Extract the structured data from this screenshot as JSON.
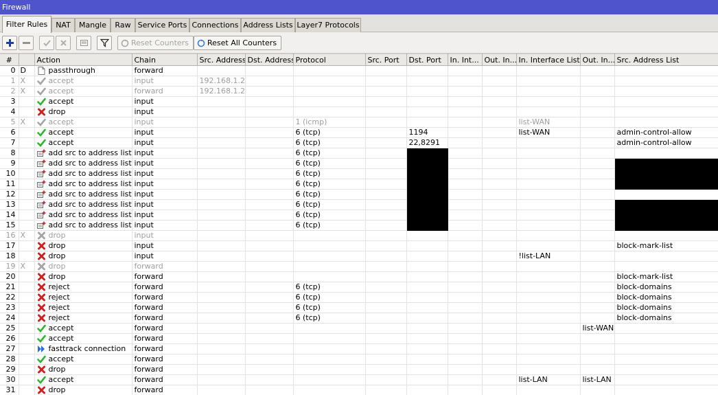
{
  "window": {
    "title": "Firewall"
  },
  "tabs": [
    {
      "label": "Filter Rules",
      "active": true
    },
    {
      "label": "NAT"
    },
    {
      "label": "Mangle"
    },
    {
      "label": "Raw"
    },
    {
      "label": "Service Ports"
    },
    {
      "label": "Connections"
    },
    {
      "label": "Address Lists"
    },
    {
      "label": "Layer7 Protocols"
    }
  ],
  "toolbar": {
    "icons": [
      "add-icon",
      "remove-icon",
      "enable-icon",
      "disable-icon",
      "comment-icon",
      "filter-icon"
    ],
    "reset_counters_label": "Reset Counters",
    "reset_all_counters_label": "Reset All Counters"
  },
  "colors": {
    "accept": "#2fb52f",
    "drop": "#d02020",
    "fasttrack": "#2a6fd6",
    "titlebar": "#4f54cd",
    "redacted": "#000000"
  },
  "table": {
    "columns": [
      "#",
      "",
      "Action",
      "Chain",
      "Src. Address",
      "Dst. Address",
      "Protocol",
      "Src. Port",
      "Dst. Port",
      "In. Int...",
      "Out. In...",
      "In. Interface List",
      "Out. In...",
      "Src. Address List"
    ],
    "rows": [
      {
        "num": "0",
        "flag": "D",
        "action": "passthrough",
        "icon": "passthrough",
        "chain": "forward",
        "disabled": false
      },
      {
        "num": "1",
        "flag": "X",
        "action": "accept",
        "icon": "accept",
        "chain": "input",
        "src": "192.168.1.2",
        "disabled": true
      },
      {
        "num": "2",
        "flag": "X",
        "action": "accept",
        "icon": "accept",
        "chain": "forward",
        "src": "192.168.1.2",
        "disabled": true
      },
      {
        "num": "3",
        "flag": "",
        "action": "accept",
        "icon": "accept",
        "chain": "input"
      },
      {
        "num": "4",
        "flag": "",
        "action": "drop",
        "icon": "drop",
        "chain": "input"
      },
      {
        "num": "5",
        "flag": "X",
        "action": "accept",
        "icon": "accept",
        "chain": "input",
        "proto": "1 (icmp)",
        "inlist": "list-WAN",
        "disabled": true
      },
      {
        "num": "6",
        "flag": "",
        "action": "accept",
        "icon": "accept",
        "chain": "input",
        "proto": "6 (tcp)",
        "dport": "1194",
        "inlist": "list-WAN",
        "srclist": "admin-control-allow"
      },
      {
        "num": "7",
        "flag": "",
        "action": "accept",
        "icon": "accept",
        "chain": "input",
        "proto": "6 (tcp)",
        "dport": "22,8291",
        "srclist": "admin-control-allow"
      },
      {
        "num": "8",
        "flag": "",
        "action": "add src to address list",
        "icon": "addlist",
        "chain": "input",
        "proto": "6 (tcp)",
        "redact_dport": true
      },
      {
        "num": "9",
        "flag": "",
        "action": "add src to address list",
        "icon": "addlist",
        "chain": "input",
        "proto": "6 (tcp)",
        "redact_dport": true,
        "redact_srclist": true
      },
      {
        "num": "10",
        "flag": "",
        "action": "add src to address list",
        "icon": "addlist",
        "chain": "input",
        "proto": "6 (tcp)",
        "redact_dport": true,
        "redact_srclist": true
      },
      {
        "num": "11",
        "flag": "",
        "action": "add src to address list",
        "icon": "addlist",
        "chain": "input",
        "proto": "6 (tcp)",
        "redact_dport": true,
        "redact_srclist": true
      },
      {
        "num": "12",
        "flag": "",
        "action": "add src to address list",
        "icon": "addlist",
        "chain": "input",
        "proto": "6 (tcp)",
        "redact_dport": true
      },
      {
        "num": "13",
        "flag": "",
        "action": "add src to address list",
        "icon": "addlist",
        "chain": "input",
        "proto": "6 (tcp)",
        "redact_dport": true,
        "redact_srclist": true
      },
      {
        "num": "14",
        "flag": "",
        "action": "add src to address list",
        "icon": "addlist",
        "chain": "input",
        "proto": "6 (tcp)",
        "redact_dport": true,
        "redact_srclist": true
      },
      {
        "num": "15",
        "flag": "",
        "action": "add src to address list",
        "icon": "addlist",
        "chain": "input",
        "proto": "6 (tcp)",
        "redact_dport": true,
        "redact_srclist": true
      },
      {
        "num": "16",
        "flag": "X",
        "action": "drop",
        "icon": "drop",
        "chain": "input",
        "disabled": true
      },
      {
        "num": "17",
        "flag": "",
        "action": "drop",
        "icon": "drop",
        "chain": "input",
        "srclist": "block-mark-list"
      },
      {
        "num": "18",
        "flag": "",
        "action": "drop",
        "icon": "drop",
        "chain": "input",
        "inlist": "!list-LAN"
      },
      {
        "num": "19",
        "flag": "X",
        "action": "drop",
        "icon": "drop",
        "chain": "forward",
        "disabled": true
      },
      {
        "num": "20",
        "flag": "",
        "action": "drop",
        "icon": "drop",
        "chain": "forward",
        "srclist": "block-mark-list"
      },
      {
        "num": "21",
        "flag": "",
        "action": "reject",
        "icon": "drop",
        "chain": "forward",
        "proto": "6 (tcp)",
        "srclist": "block-domains"
      },
      {
        "num": "22",
        "flag": "",
        "action": "reject",
        "icon": "drop",
        "chain": "forward",
        "proto": "6 (tcp)",
        "srclist": "block-domains"
      },
      {
        "num": "23",
        "flag": "",
        "action": "reject",
        "icon": "drop",
        "chain": "forward",
        "proto": "6 (tcp)",
        "srclist": "block-domains"
      },
      {
        "num": "24",
        "flag": "",
        "action": "reject",
        "icon": "drop",
        "chain": "forward",
        "proto": "6 (tcp)",
        "srclist": "block-domains"
      },
      {
        "num": "25",
        "flag": "",
        "action": "accept",
        "icon": "accept",
        "chain": "forward",
        "outlist": "list-WAN"
      },
      {
        "num": "26",
        "flag": "",
        "action": "accept",
        "icon": "accept",
        "chain": "forward"
      },
      {
        "num": "27",
        "flag": "",
        "action": "fasttrack connection",
        "icon": "fasttrack",
        "chain": "forward"
      },
      {
        "num": "28",
        "flag": "",
        "action": "accept",
        "icon": "accept",
        "chain": "forward"
      },
      {
        "num": "29",
        "flag": "",
        "action": "drop",
        "icon": "drop",
        "chain": "forward"
      },
      {
        "num": "30",
        "flag": "",
        "action": "accept",
        "icon": "accept",
        "chain": "forward",
        "inlist": "list-LAN",
        "outlist": "list-LAN"
      },
      {
        "num": "31",
        "flag": "",
        "action": "drop",
        "icon": "drop",
        "chain": "forward"
      }
    ]
  }
}
